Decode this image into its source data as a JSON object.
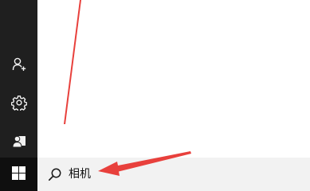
{
  "start_menu": {
    "rail_items": [
      {
        "icon": "user-add-icon"
      },
      {
        "icon": "gear-icon"
      },
      {
        "icon": "contact-card-icon"
      }
    ],
    "start_icon": "windows-logo-icon"
  },
  "search": {
    "icon": "search-icon",
    "query": "相机"
  },
  "colors": {
    "rail_background": "#1f1f1f",
    "search_background": "#f2f2f2",
    "annotation_red": "#e8403c"
  }
}
